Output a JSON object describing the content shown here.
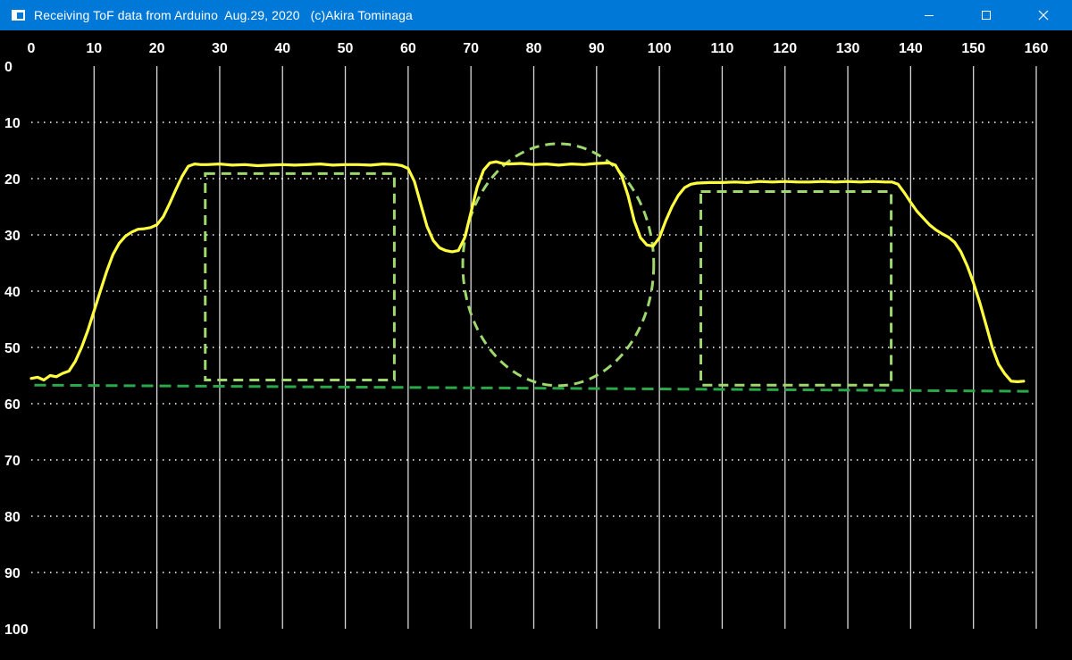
{
  "window": {
    "title": "Receiving ToF data from Arduino  Aug.29, 2020   (c)Akira Tominaga",
    "controls": {
      "minimize": "minimize-icon",
      "maximize": "maximize-icon",
      "close": "close-icon"
    },
    "titlebar_color": "#0078d7"
  },
  "colors": {
    "background": "#000000",
    "grid": "#ffffff",
    "series": "#ffff40",
    "annotation": "#9ed86e",
    "baseline": "#2aa84a"
  },
  "chart_data": {
    "type": "line",
    "title": "",
    "xlabel": "",
    "ylabel": "",
    "xlim": [
      0,
      160
    ],
    "ylim": [
      0,
      100
    ],
    "y_inverted": true,
    "x_ticks": [
      0,
      10,
      20,
      30,
      40,
      50,
      60,
      70,
      80,
      90,
      100,
      110,
      120,
      130,
      140,
      150,
      160
    ],
    "y_ticks": [
      0,
      10,
      20,
      30,
      40,
      50,
      60,
      70,
      80,
      90,
      100
    ],
    "vertical_grid": "solid",
    "horizontal_grid": "dotted",
    "series": [
      {
        "x": [
          0,
          1,
          2,
          3,
          4,
          5,
          6,
          7,
          8,
          9,
          10,
          11,
          12,
          13,
          14,
          15,
          16,
          17,
          18,
          19,
          20,
          21,
          22,
          23,
          24,
          25,
          26,
          27,
          28,
          30,
          32,
          34,
          36,
          38,
          40,
          42,
          44,
          46,
          48,
          50,
          52,
          54,
          56,
          58,
          59,
          60,
          61,
          62,
          63,
          64,
          65,
          66,
          67,
          68,
          69,
          70,
          71,
          72,
          73,
          74,
          75,
          76,
          78,
          80,
          82,
          84,
          86,
          88,
          90,
          92,
          93,
          94,
          95,
          96,
          97,
          98,
          99,
          100,
          101,
          102,
          103,
          104,
          105,
          106,
          108,
          110,
          112,
          114,
          116,
          118,
          120,
          122,
          124,
          126,
          128,
          130,
          132,
          134,
          136,
          137,
          138,
          139,
          140,
          141,
          142,
          143,
          144,
          145,
          146,
          147,
          148,
          149,
          150,
          151,
          152,
          153,
          154,
          155,
          156,
          157,
          158
        ],
        "y": [
          55.5,
          55.3,
          55.8,
          55,
          55.2,
          54.6,
          54.2,
          52.5,
          50,
          47,
          43.5,
          40,
          36.5,
          33.5,
          31.5,
          30.2,
          29.5,
          29,
          28.9,
          28.7,
          28.2,
          26.8,
          24.5,
          22,
          19.6,
          17.8,
          17.4,
          17.5,
          17.5,
          17.4,
          17.6,
          17.5,
          17.7,
          17.6,
          17.5,
          17.6,
          17.5,
          17.4,
          17.6,
          17.5,
          17.5,
          17.6,
          17.4,
          17.5,
          17.7,
          18.2,
          20.5,
          24.5,
          28.5,
          31,
          32.3,
          32.8,
          33,
          32.8,
          30.5,
          26,
          21.5,
          18.5,
          17.2,
          17,
          17.3,
          17.4,
          17.3,
          17.5,
          17.4,
          17.6,
          17.4,
          17.5,
          17.3,
          17.2,
          17.6,
          19.5,
          23,
          27.5,
          30.5,
          31.8,
          32,
          30.5,
          27.5,
          25,
          23,
          21.6,
          21,
          20.8,
          20.7,
          20.7,
          20.6,
          20.7,
          20.5,
          20.6,
          20.5,
          20.6,
          20.6,
          20.5,
          20.6,
          20.5,
          20.6,
          20.5,
          20.6,
          20.6,
          21,
          22.5,
          24.2,
          25.8,
          27,
          28.2,
          29.1,
          29.8,
          30.4,
          31.3,
          33,
          35.5,
          38.5,
          42,
          46,
          50,
          53,
          54.7,
          56,
          56.1,
          56
        ]
      }
    ],
    "annotations": [
      {
        "shape": "rect",
        "x0": 27.7,
        "x1": 57.8,
        "y0": 19.1,
        "y1": 55.8
      },
      {
        "shape": "ellipse",
        "cx": 83.9,
        "cy": 35.3,
        "rx": 15.2,
        "ry": 21.5
      },
      {
        "shape": "rect",
        "x0": 106.6,
        "x1": 136.9,
        "y0": 22.3,
        "y1": 56.7
      },
      {
        "shape": "line",
        "x0": 0.5,
        "y0": 56.7,
        "x1": 159.3,
        "y1": 57.8
      }
    ]
  }
}
